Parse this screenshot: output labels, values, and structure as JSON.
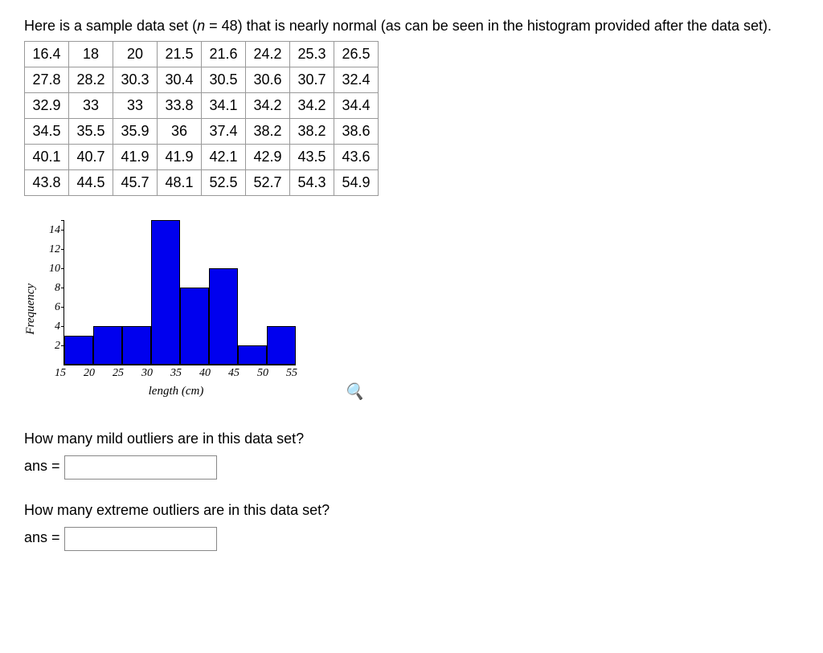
{
  "intro_prefix": "Here is a sample data set (",
  "intro_n": "n",
  "intro_eq": " = ",
  "intro_nval": "48",
  "intro_suffix": ") that is nearly normal (as can be seen in the histogram provided after the data set).",
  "data_rows": [
    [
      "16.4",
      "18",
      "20",
      "21.5",
      "21.6",
      "24.2",
      "25.3",
      "26.5"
    ],
    [
      "27.8",
      "28.2",
      "30.3",
      "30.4",
      "30.5",
      "30.6",
      "30.7",
      "32.4"
    ],
    [
      "32.9",
      "33",
      "33",
      "33.8",
      "34.1",
      "34.2",
      "34.2",
      "34.4"
    ],
    [
      "34.5",
      "35.5",
      "35.9",
      "36",
      "37.4",
      "38.2",
      "38.2",
      "38.6"
    ],
    [
      "40.1",
      "40.7",
      "41.9",
      "41.9",
      "42.1",
      "42.9",
      "43.5",
      "43.6"
    ],
    [
      "43.8",
      "44.5",
      "45.7",
      "48.1",
      "52.5",
      "52.7",
      "54.3",
      "54.9"
    ]
  ],
  "chart_data": {
    "type": "bar",
    "categories": [
      "15-20",
      "20-25",
      "25-30",
      "30-35",
      "35-40",
      "40-45",
      "45-50",
      "50-55"
    ],
    "values": [
      3,
      4,
      4,
      15,
      8,
      10,
      2,
      4
    ],
    "xticks": [
      "15",
      "20",
      "25",
      "30",
      "35",
      "40",
      "45",
      "50",
      "55"
    ],
    "yticks": [
      "2",
      "4",
      "6",
      "8",
      "10",
      "12",
      "14"
    ],
    "xlabel": "length (cm)",
    "ylabel": "Frequency",
    "ylim": [
      0,
      15
    ]
  },
  "question1": "How many mild outliers are in this data set?",
  "question2": "How many extreme outliers are in this data set?",
  "ans_label": "ans = ",
  "magnify_icon": "🔍"
}
